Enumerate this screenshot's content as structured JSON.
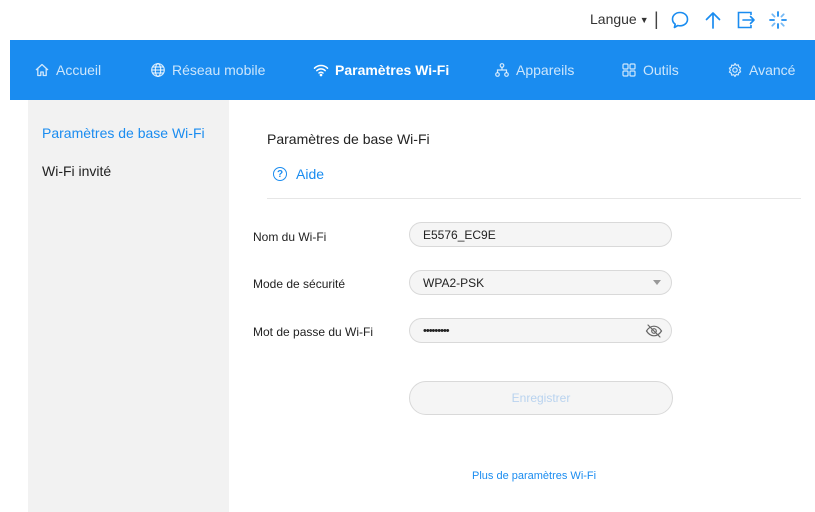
{
  "header": {
    "language_label": "Langue",
    "separator": "|",
    "icons": [
      "speech-bubble-icon",
      "arrow-up-icon",
      "logout-icon",
      "loading-spinner-icon"
    ]
  },
  "nav": {
    "items": [
      {
        "label": "Accueil",
        "icon": "home-icon",
        "active": false
      },
      {
        "label": "Réseau mobile",
        "icon": "globe-icon",
        "active": false
      },
      {
        "label": "Paramètres Wi-Fi",
        "icon": "wifi-icon",
        "active": true
      },
      {
        "label": "Appareils",
        "icon": "devices-icon",
        "active": false
      },
      {
        "label": "Outils",
        "icon": "grid-icon",
        "active": false
      },
      {
        "label": "Avancé",
        "icon": "gear-icon",
        "active": false
      }
    ]
  },
  "sidebar": {
    "items": [
      {
        "label": "Paramètres de base Wi-Fi",
        "active": true
      },
      {
        "label": "Wi-Fi invité",
        "active": false
      }
    ]
  },
  "main": {
    "title": "Paramètres de base Wi-Fi",
    "help_label": "Aide",
    "help_glyph": "?",
    "fields": {
      "ssid_label": "Nom du Wi-Fi",
      "ssid_value": "E5576_EC9E",
      "security_label": "Mode de sécurité",
      "security_value": "WPA2-PSK",
      "password_label": "Mot de passe du Wi-Fi",
      "password_value": "•••••••••"
    },
    "save_label": "Enregistrer",
    "more_link": "Plus de paramètres Wi-Fi"
  },
  "colors": {
    "accent": "#1a8cf0",
    "sidebar_bg": "#f2f2f2",
    "disabled_text": "#b9d3ef"
  }
}
